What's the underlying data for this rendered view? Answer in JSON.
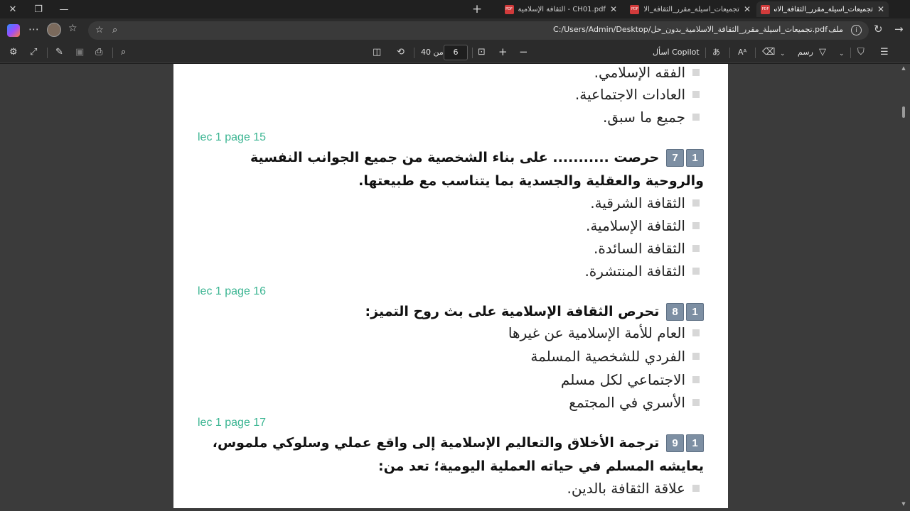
{
  "tabs": [
    {
      "label": "تجميعات_اسيلة_مقرر_الثقافة_الاسلا",
      "active": true
    },
    {
      "label": "تجميعات_اسيلة_مقرر_الثقافة_الا",
      "active": false
    },
    {
      "label": "CH01.pdf - الثقافة الإسلامية",
      "active": false
    }
  ],
  "pdf_badge": "PDF",
  "address": {
    "url": "C:/Users/Admin/Desktop/تجميعات_اسيلة_مقرر_الثقافة_الاسلامية_بدون_حل.pdf",
    "file_label": "ملف"
  },
  "toolbar": {
    "draw_label": "رسم",
    "copilot_label": "اسأل Copilot",
    "page_current": "6",
    "page_of": "من 40"
  },
  "document": {
    "top_options": [
      "الفقه الإسلامي.",
      "العادات الاجتماعية.",
      "جميع ما سبق."
    ],
    "questions": [
      {
        "ref": "lec 1 page 15",
        "num_badges": [
          "1",
          "7"
        ],
        "text": "حرصت ........... على بناء الشخصية من جميع الجوانب النفسية والروحية والعقلية والجسدية بما يتناسب مع طبيعتها.",
        "options": [
          "الثقافة الشرقية.",
          "الثقافة الإسلامية.",
          "الثقافة السائدة.",
          "الثقافة المنتشرة."
        ]
      },
      {
        "ref": "lec 1 page 16",
        "num_badges": [
          "1",
          "8"
        ],
        "text": "تحرص الثقافة الإسلامية على بث روح التميز:",
        "options": [
          "العام للأمة الإسلامية عن غيرها",
          "الفردي للشخصية المسلمة",
          "الاجتماعي لكل مسلم",
          "الأسري في المجتمع"
        ]
      },
      {
        "ref": "lec 1 page 17",
        "num_badges": [
          "1",
          "9"
        ],
        "text": "ترجمة الأخلاق والتعاليم الإسلامية إلى واقع عملي وسلوكي ملموس، يعايشه المسلم في حياته العملية اليومية؛ تعد من:",
        "options": [
          "علاقة الثقافة بالدين."
        ]
      }
    ]
  }
}
